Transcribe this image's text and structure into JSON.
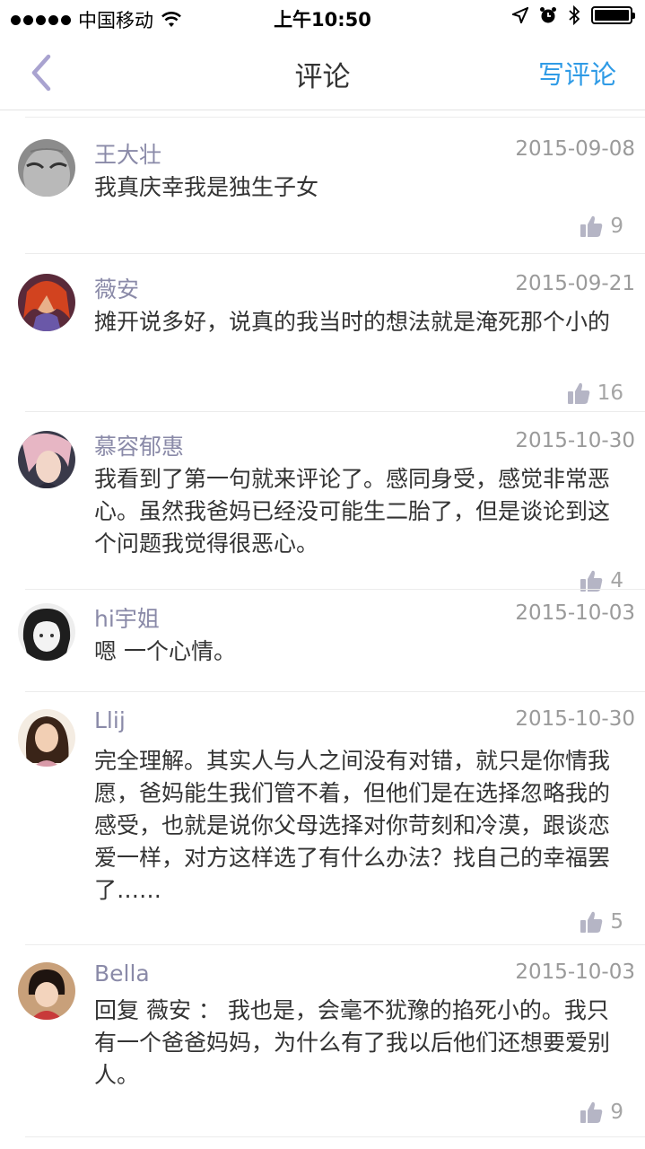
{
  "status_bar": {
    "carrier": "中国移动",
    "time": "上午10:50"
  },
  "nav": {
    "title": "评论",
    "write_label": "写评论"
  },
  "comments": [
    {
      "user": "王大壮",
      "date": "2015-09-08",
      "text": "我真庆幸我是独生子女",
      "likes": "9"
    },
    {
      "user": "薇安",
      "date": "2015-09-21",
      "text": "摊开说多好，说真的我当时的想法就是淹死那个小的",
      "likes": "16"
    },
    {
      "user": "慕容郁惠",
      "date": "2015-10-30",
      "text": "我看到了第一句就来评论了。感同身受，感觉非常恶心。虽然我爸妈已经没可能生二胎了，但是谈论到这个问题我觉得很恶心。",
      "likes": "4"
    },
    {
      "user": "hi宇姐",
      "date": "2015-10-03",
      "text": "嗯 一个心情。",
      "likes": ""
    },
    {
      "user": "Llij",
      "date": "2015-10-30",
      "text": "完全理解。其实人与人之间没有对错，就只是你情我愿，爸妈能生我们管不着，但他们是在选择忽略我的感受，也就是说你父母选择对你苛刻和冷漠，跟谈恋爱一样，对方这样选了有什么办法？找自己的幸福罢了……",
      "likes": "5"
    },
    {
      "user": "Bella",
      "date": "2015-10-03",
      "text": "回复 薇安 ： 我也是，会毫不犹豫的掐死小的。我只有一个爸爸妈妈，为什么有了我以后他们还想要爱别人。",
      "likes": "9"
    }
  ],
  "colors": {
    "accent": "#2f9be6",
    "username": "#8a8aa8",
    "back": "#a9a3d0"
  }
}
